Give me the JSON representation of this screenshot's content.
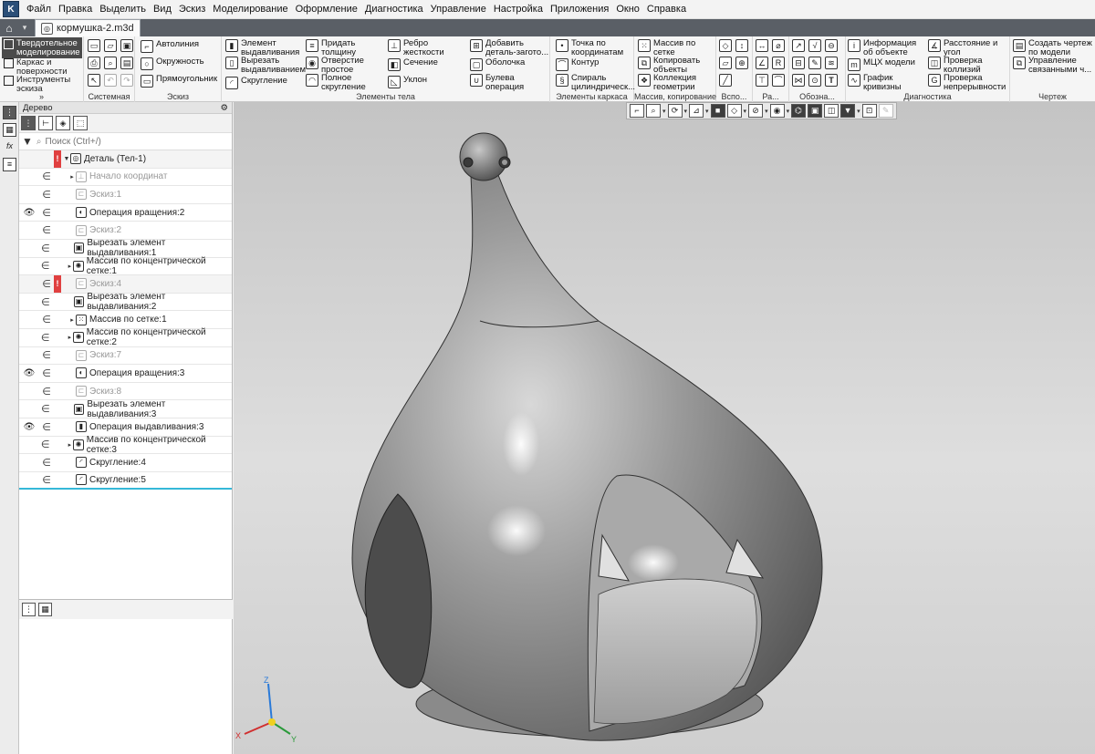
{
  "menu": [
    "Файл",
    "Правка",
    "Выделить",
    "Вид",
    "Эскиз",
    "Моделирование",
    "Оформление",
    "Диагностика",
    "Управление",
    "Настройка",
    "Приложения",
    "Окно",
    "Справка"
  ],
  "tab": {
    "filename": "кормушка-2.m3d"
  },
  "ribbon": {
    "modes": [
      "Твердотельное моделирование",
      "Каркас и поверхности",
      "Инструменты эскиза"
    ],
    "system_label": "Системная",
    "sketch": {
      "label": "Эскиз",
      "items": [
        "Автолиния",
        "Окружность",
        "Прямоугольник"
      ]
    },
    "body": {
      "label": "Элементы тела",
      "items": [
        "Элемент выдавливания",
        "Вырезать выдавливанием",
        "Скругление",
        "Придать толщину",
        "Отверстие простое",
        "Полное скругление",
        "Ребро жесткости",
        "Сечение",
        "Уклон",
        "Добавить деталь-загото...",
        "Оболочка",
        "Булева операция"
      ]
    },
    "frame": {
      "label": "Элементы каркаса",
      "items": [
        "Точка по координатам",
        "Контур",
        "Спираль цилиндрическ..."
      ]
    },
    "array": {
      "label": "Массив, копирование",
      "items": [
        "Массив по сетке",
        "Копировать объекты",
        "Коллекция геометрии"
      ]
    },
    "aux_label": "Вспо...",
    "sizes_label": "Ра...",
    "notation_label": "Обозна...",
    "diag": {
      "label": "Диагностика",
      "items": [
        "Информация об объекте",
        "МЦХ модели",
        "График кривизны",
        "Расстояние и угол",
        "Проверка коллизий",
        "Проверка непрерывности"
      ]
    },
    "drawing": {
      "label": "Чертеж",
      "items": [
        "Создать чертеж по модели",
        "Управление связанными ч..."
      ]
    }
  },
  "tree": {
    "title": "Дерево",
    "search_placeholder": "Поиск (Ctrl+/)",
    "root": "Деталь (Тел-1)",
    "items": [
      {
        "label": "Начало координат",
        "visible": false,
        "expandable": true,
        "dim": true,
        "error": false
      },
      {
        "label": "Эскиз:1",
        "visible": false,
        "expandable": false,
        "dim": true,
        "error": false
      },
      {
        "label": "Операция вращения:2",
        "visible": true,
        "expandable": false,
        "dim": false,
        "error": false
      },
      {
        "label": "Эскиз:2",
        "visible": false,
        "expandable": false,
        "dim": true,
        "error": false
      },
      {
        "label": "Вырезать элемент выдавливания:1",
        "visible": false,
        "expandable": false,
        "dim": false,
        "error": false
      },
      {
        "label": "Массив по концентрической сетке:1",
        "visible": false,
        "expandable": true,
        "dim": false,
        "error": false
      },
      {
        "label": "Эскиз:4",
        "visible": false,
        "expandable": false,
        "dim": true,
        "error": true
      },
      {
        "label": "Вырезать элемент выдавливания:2",
        "visible": false,
        "expandable": false,
        "dim": false,
        "error": false
      },
      {
        "label": "Массив по сетке:1",
        "visible": false,
        "expandable": true,
        "dim": false,
        "error": false
      },
      {
        "label": "Массив по концентрической сетке:2",
        "visible": false,
        "expandable": true,
        "dim": false,
        "error": false
      },
      {
        "label": "Эскиз:7",
        "visible": false,
        "expandable": false,
        "dim": true,
        "error": false
      },
      {
        "label": "Операция вращения:3",
        "visible": true,
        "expandable": false,
        "dim": false,
        "error": false
      },
      {
        "label": "Эскиз:8",
        "visible": false,
        "expandable": false,
        "dim": true,
        "error": false
      },
      {
        "label": "Вырезать элемент выдавливания:3",
        "visible": false,
        "expandable": false,
        "dim": false,
        "error": false
      },
      {
        "label": "Операция выдавливания:3",
        "visible": true,
        "expandable": false,
        "dim": false,
        "error": false
      },
      {
        "label": "Массив по концентрической сетке:3",
        "visible": false,
        "expandable": true,
        "dim": false,
        "error": false
      },
      {
        "label": "Скругление:4",
        "visible": false,
        "expandable": false,
        "dim": false,
        "error": false
      },
      {
        "label": "Скругление:5",
        "visible": false,
        "expandable": false,
        "dim": false,
        "error": false
      }
    ]
  },
  "triad": {
    "x": "X",
    "y": "Y",
    "z": "Z"
  },
  "colors": {
    "accent_selection": "#35b8d8",
    "error": "#e04040",
    "tab_bar": "#5a5f66"
  }
}
